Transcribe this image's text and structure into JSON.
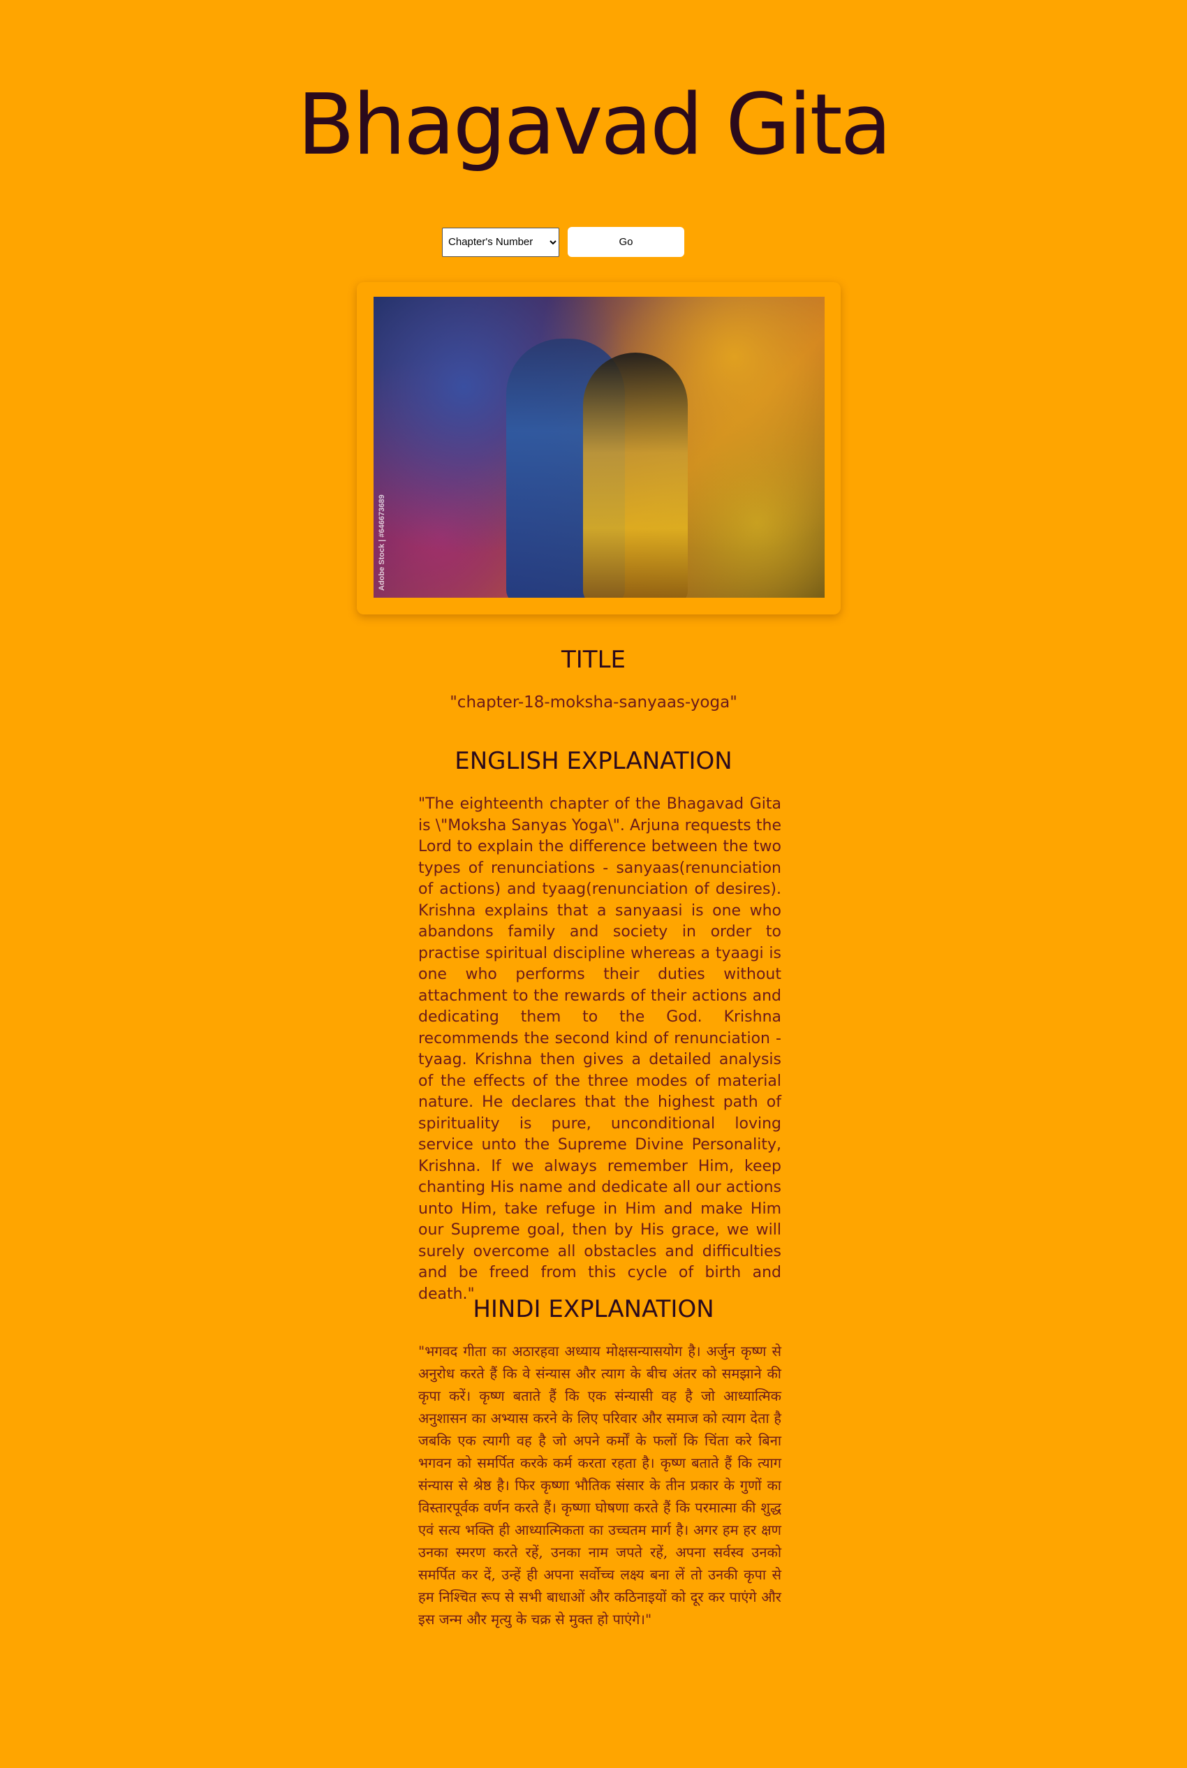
{
  "header": {
    "title": "Bhagavad Gita"
  },
  "controls": {
    "chapter_select": {
      "selected": "Chapter's Number",
      "options": [
        "Chapter's Number"
      ]
    },
    "go_label": "Go"
  },
  "hero_image": {
    "watermark": "Adobe Stock | #646673689"
  },
  "sections": {
    "title": {
      "heading": "TITLE",
      "value": "\"chapter-18-moksha-sanyaas-yoga\""
    },
    "english": {
      "heading": "ENGLISH EXPLANATION",
      "text": "\"The eighteenth chapter of the Bhagavad Gita is \\\"Moksha Sanyas Yoga\\\". Arjuna requests the Lord to explain the difference between the two types of renunciations - sanyaas(renunciation of actions) and tyaag(renunciation of desires). Krishna explains that a sanyaasi is one who abandons family and society in order to practise spiritual discipline whereas a tyaagi is one who performs their duties without attachment to the rewards of their actions and dedicating them to the God. Krishna recommends the second kind of renunciation - tyaag. Krishna then gives a detailed analysis of the effects of the three modes of material nature. He declares that the highest path of spirituality is pure, unconditional loving service unto the Supreme Divine Personality, Krishna. If we always remember Him, keep chanting His name and dedicate all our actions unto Him, take refuge in Him and make Him our Supreme goal, then by His grace, we will surely overcome all obstacles and difficulties and be freed from this cycle of birth and death.\""
    },
    "hindi": {
      "heading": "HINDI EXPLANATION",
      "text": "\"भगवद गीता का अठारहवा अध्याय मोक्षसन्यासयोग है। अर्जुन कृष्ण से अनुरोध करते हैं कि वे संन्यास और त्याग के बीच अंतर को समझाने की कृपा करें। कृष्ण बताते हैं कि एक संन्यासी वह है जो आध्यात्मिक अनुशासन का अभ्यास करने के लिए परिवार और समाज को त्याग देता है जबकि एक त्यागी वह है जो अपने कर्मों के फलों कि चिंता करे बिना भगवन को समर्पित करके कर्म करता रहता है। कृष्ण बताते हैं कि त्याग संन्यास से श्रेष्ठ है। फिर कृष्णा भौतिक संसार के तीन प्रकार के गुणों का विस्तारपूर्वक वर्णन करते हैं। कृष्णा घोषणा करते हैं कि परमात्मा की शुद्ध एवं सत्य भक्ति ही आध्यात्मिकता का उच्चतम मार्ग है। अगर हम हर क्षण उनका स्मरण करते रहें, उनका नाम जपते रहें, अपना सर्वस्व उनको समर्पित कर दें, उन्हें ही अपना सर्वोच्च लक्ष्य बना लें तो उनकी कृपा से हम निश्चित रूप से सभी बाधाओं और कठिनाइयों को दूर कर पाएंगे और इस जन्म और मृत्यु के चक्र से मुक्त हो पाएंगे।\""
    }
  },
  "colors": {
    "background": "#FFA500",
    "heading": "#2b0a1c",
    "body_text": "#6b1a1a"
  }
}
